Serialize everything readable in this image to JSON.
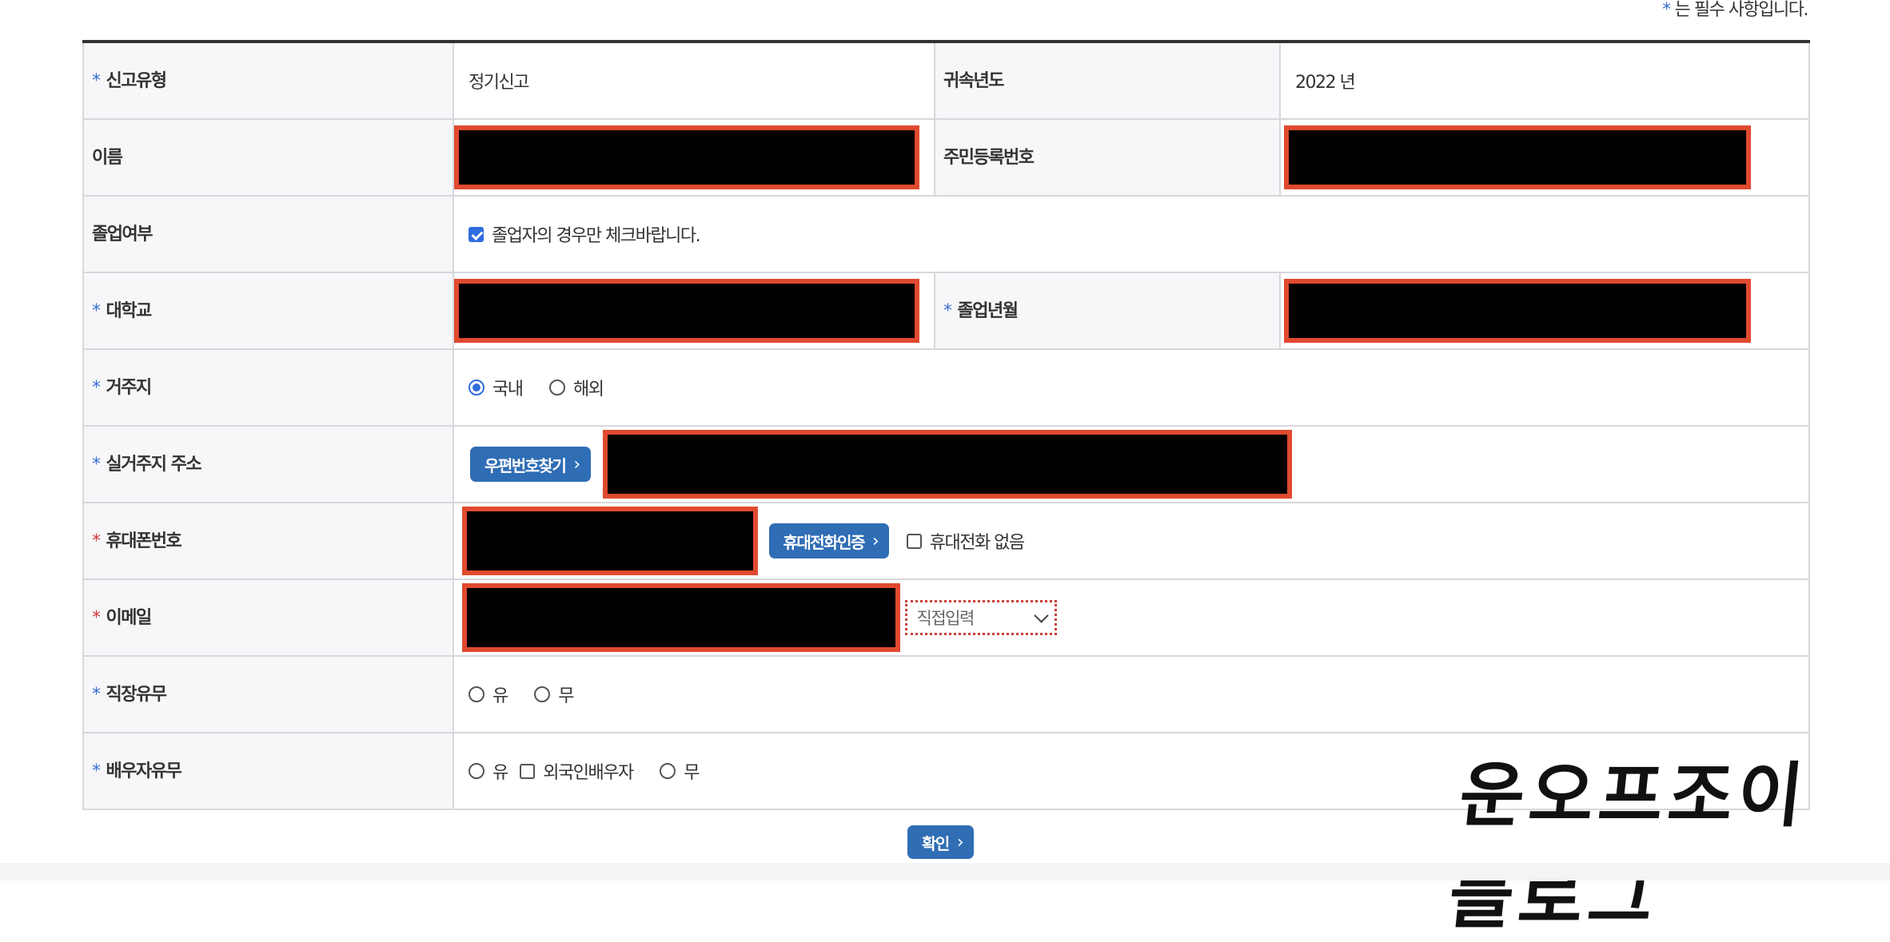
{
  "required_note": {
    "star": "*",
    "text": "는 필수 사항입니다."
  },
  "rows": {
    "report_type": {
      "label": "신고유형",
      "value": "정기신고"
    },
    "year": {
      "label": "귀속년도",
      "value": "2022 년"
    },
    "name": {
      "label": "이름"
    },
    "rrn": {
      "label": "주민등록번호"
    },
    "graduated": {
      "label": "졸업여부",
      "checkbox_label": "졸업자의 경우만 체크바랍니다.",
      "checked": true
    },
    "university": {
      "label": "대학교"
    },
    "grad_date": {
      "label": "졸업년월"
    },
    "residence": {
      "label": "거주지",
      "options": [
        "국내",
        "해외"
      ],
      "selected": "국내"
    },
    "address": {
      "label": "실거주지 주소",
      "button": "우편번호찾기"
    },
    "phone": {
      "label": "휴대폰번호",
      "button": "휴대전화인증",
      "no_phone_label": "휴대전화 없음"
    },
    "email": {
      "label": "이메일",
      "domain_select": "직접입력"
    },
    "employment": {
      "label": "직장유무",
      "options": [
        "유",
        "무"
      ]
    },
    "spouse": {
      "label": "배우자유무",
      "options": [
        "유",
        "무"
      ],
      "foreign_spouse_label": "외국인배우자"
    }
  },
  "confirm_button": "확인",
  "watermark": "운오프조이 블로그",
  "colors": {
    "primary_button": "#2f6db5",
    "required_star": "#3a6fd1",
    "required_star_red": "#d23b3b",
    "redaction_border": "#e04a2f"
  },
  "icons": {
    "button_chevron": "chevron-right-icon",
    "select_chevron": "chevron-down-icon"
  }
}
